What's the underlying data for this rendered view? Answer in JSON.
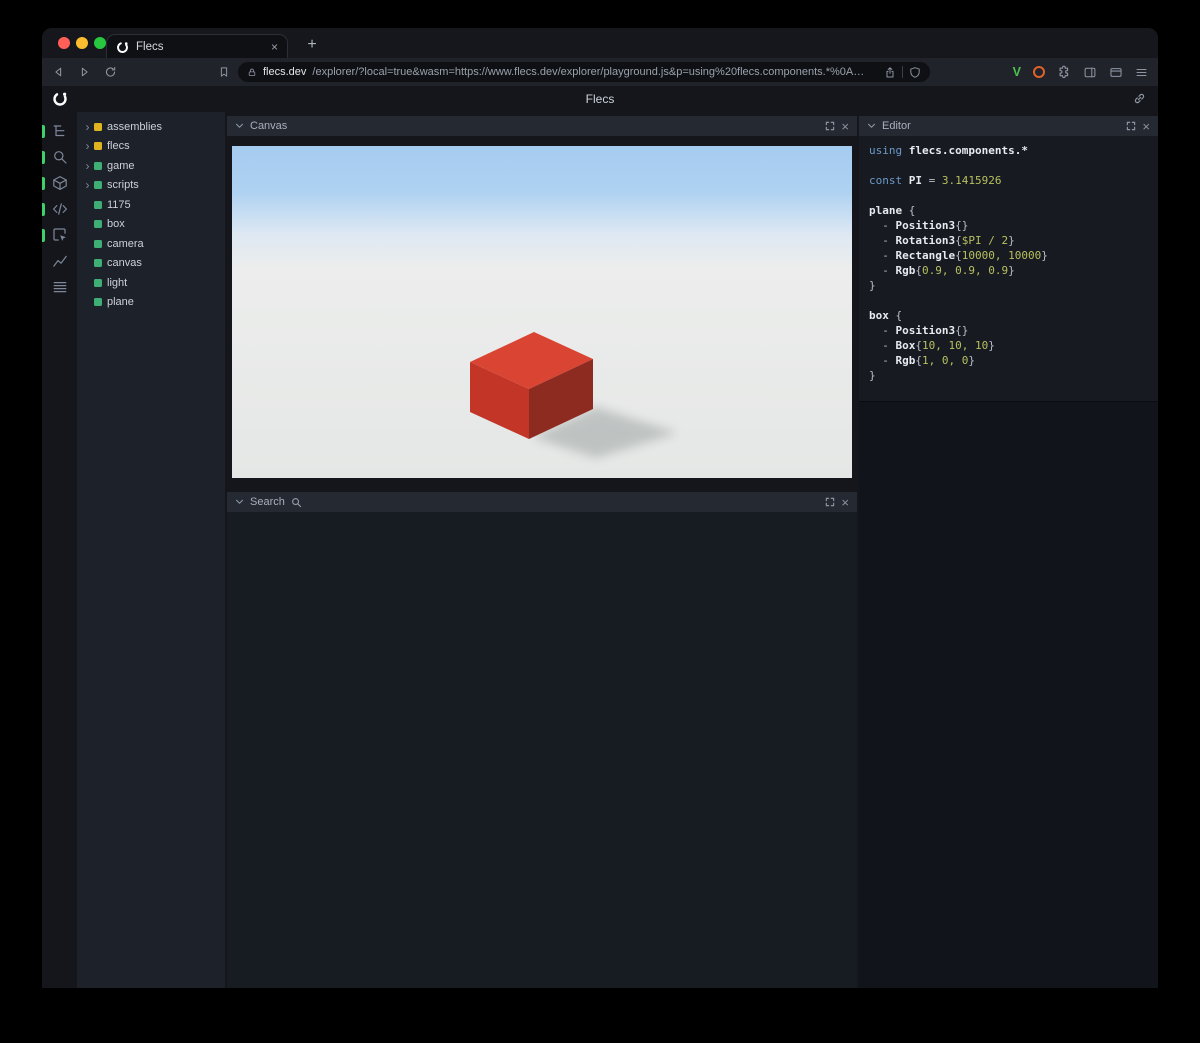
{
  "theme": {
    "tl-red": "#ff5f57",
    "tl-yellow": "#febc2e",
    "tl-green": "#28c740",
    "rail-indicator": "#3ed06a",
    "v-green": "#4bc44b",
    "orange-ring": "#e0622a"
  },
  "browser": {
    "tab_title": "Flecs",
    "glyphs": {
      "close": "×",
      "plus": "+"
    },
    "url_host": "flecs.dev",
    "url_rest": "/explorer/?local=true&wasm=https://www.flecs.dev/explorer/playground.js&p=using%20flecs.components.*%0A…",
    "v_label": "V"
  },
  "page": {
    "title": "Flecs"
  },
  "rail": {
    "icons": [
      {
        "name": "entity-tree",
        "active": true
      },
      {
        "name": "search",
        "active": true
      },
      {
        "name": "cube",
        "active": true
      },
      {
        "name": "code",
        "active": true
      },
      {
        "name": "inspect",
        "active": true
      },
      {
        "name": "chart",
        "active": false
      },
      {
        "name": "rows",
        "active": false
      }
    ]
  },
  "tree": {
    "items": [
      {
        "label": "assemblies",
        "color": "#e0b321",
        "expandable": true
      },
      {
        "label": "flecs",
        "color": "#e0b321",
        "expandable": true
      },
      {
        "label": "game",
        "color": "#3fae74",
        "expandable": true
      },
      {
        "label": "scripts",
        "color": "#3fae74",
        "expandable": true
      },
      {
        "label": "1175",
        "color": "#3fae74",
        "expandable": false
      },
      {
        "label": "box",
        "color": "#3fae74",
        "expandable": false
      },
      {
        "label": "camera",
        "color": "#3fae74",
        "expandable": false
      },
      {
        "label": "canvas",
        "color": "#3fae74",
        "expandable": false
      },
      {
        "label": "light",
        "color": "#3fae74",
        "expandable": false
      },
      {
        "label": "plane",
        "color": "#3fae74",
        "expandable": false
      }
    ]
  },
  "panels": {
    "canvas_title": "Canvas",
    "search_title": "Search",
    "editor_title": "Editor",
    "close_glyph": "×"
  },
  "scene": {
    "sky_top": "#a5cbf0",
    "sky_mid": "#afd2f2",
    "horizon": "#dfe9f3",
    "ground": "#ecedec",
    "ground_bottom": "#e5e7e6",
    "box_top": "#da4433",
    "box_front": "#c23527",
    "box_side": "#8e2b20",
    "shadow": "#8f9695"
  },
  "editor": {
    "lines": [
      [
        {
          "t": "using",
          "c": "kw"
        },
        {
          "t": " flecs.components.*",
          "c": "id"
        }
      ],
      [],
      [
        {
          "t": "const",
          "c": "kw"
        },
        {
          "t": " PI",
          "c": "id"
        },
        {
          "t": " = ",
          "c": "pl"
        },
        {
          "t": "3.1415926",
          "c": "num"
        }
      ],
      [],
      [
        {
          "t": "plane",
          "c": "id"
        },
        {
          "t": " {",
          "c": "pl"
        }
      ],
      [
        {
          "t": "  - ",
          "c": "pl"
        },
        {
          "t": "Position3",
          "c": "id"
        },
        {
          "t": "{}",
          "c": "pl"
        }
      ],
      [
        {
          "t": "  - ",
          "c": "pl"
        },
        {
          "t": "Rotation3",
          "c": "id"
        },
        {
          "t": "{",
          "c": "pl"
        },
        {
          "t": "$PI / 2",
          "c": "num"
        },
        {
          "t": "}",
          "c": "pl"
        }
      ],
      [
        {
          "t": "  - ",
          "c": "pl"
        },
        {
          "t": "Rectangle",
          "c": "id"
        },
        {
          "t": "{",
          "c": "pl"
        },
        {
          "t": "10000, 10000",
          "c": "num"
        },
        {
          "t": "}",
          "c": "pl"
        }
      ],
      [
        {
          "t": "  - ",
          "c": "pl"
        },
        {
          "t": "Rgb",
          "c": "id"
        },
        {
          "t": "{",
          "c": "pl"
        },
        {
          "t": "0.9, 0.9, 0.9",
          "c": "num"
        },
        {
          "t": "}",
          "c": "pl"
        }
      ],
      [
        {
          "t": "}",
          "c": "pl"
        }
      ],
      [],
      [
        {
          "t": "box",
          "c": "id"
        },
        {
          "t": " {",
          "c": "pl"
        }
      ],
      [
        {
          "t": "  - ",
          "c": "pl"
        },
        {
          "t": "Position3",
          "c": "id"
        },
        {
          "t": "{}",
          "c": "pl"
        }
      ],
      [
        {
          "t": "  - ",
          "c": "pl"
        },
        {
          "t": "Box",
          "c": "id"
        },
        {
          "t": "{",
          "c": "pl"
        },
        {
          "t": "10, 10, 10",
          "c": "num"
        },
        {
          "t": "}",
          "c": "pl"
        }
      ],
      [
        {
          "t": "  - ",
          "c": "pl"
        },
        {
          "t": "Rgb",
          "c": "id"
        },
        {
          "t": "{",
          "c": "pl"
        },
        {
          "t": "1, 0, 0",
          "c": "num"
        },
        {
          "t": "}",
          "c": "pl"
        }
      ],
      [
        {
          "t": "}",
          "c": "pl"
        }
      ]
    ]
  }
}
